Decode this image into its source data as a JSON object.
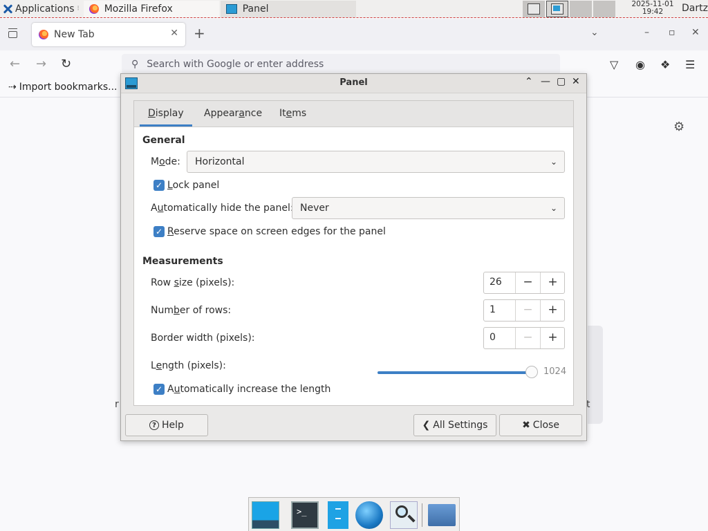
{
  "top_panel": {
    "apps_label": "Applications",
    "tasks": [
      {
        "label": "Mozilla Firefox",
        "icon": "firefox-icon"
      },
      {
        "label": "Panel",
        "icon": "panel-icon"
      }
    ],
    "clock": {
      "date": "2025-11-01",
      "time": "19:42"
    },
    "user": "Dartz"
  },
  "firefox": {
    "tab_title": "New Tab",
    "tab_close": "✕",
    "new_tab": "+",
    "overflow": "⌄",
    "window": {
      "minimize": "–",
      "maximize": "▫",
      "close": "✕"
    },
    "nav": {
      "back": "←",
      "forward": "→",
      "reload": "↻"
    },
    "url_placeholder": "Search with Google or enter address",
    "bookmarks_import": "Import bookmarks...",
    "bg_letter_left": "r",
    "bg_letter_right": "t"
  },
  "dialog": {
    "title": "Panel",
    "tabs": [
      {
        "pre": "",
        "u": "D",
        "post": "isplay"
      },
      {
        "pre": "Appear",
        "u": "a",
        "post": "nce"
      },
      {
        "pre": "It",
        "u": "e",
        "post": "ms"
      }
    ],
    "general_heading": "General",
    "mode": {
      "pre": "M",
      "u": "o",
      "post": "de:",
      "value": "Horizontal"
    },
    "lock_panel": {
      "u": "L",
      "post": "ock panel",
      "checked": true
    },
    "autohide": {
      "pre": "A",
      "u": "u",
      "post": "tomatically hide the panel:",
      "value": "Never"
    },
    "reserve_space": {
      "u": "R",
      "post": "eserve space on screen edges for the panel",
      "checked": true
    },
    "measurements_heading": "Measurements",
    "row_size": {
      "pre": "Row ",
      "u": "s",
      "post": "ize (pixels):",
      "value": "26"
    },
    "num_rows": {
      "pre": "Num",
      "u": "b",
      "post": "er of rows:",
      "value": "1"
    },
    "border_width": {
      "pre": "Border width (pixels):",
      "value": "0"
    },
    "length": {
      "pre": "L",
      "u": "e",
      "post": "ngth (pixels):",
      "value": "1024",
      "fraction": 1.0
    },
    "auto_increase": {
      "pre": "A",
      "u": "u",
      "post": "tomatically increase the length",
      "checked": true
    },
    "buttons": {
      "help": "Help",
      "all_settings": "All Settings",
      "close": "Close"
    }
  },
  "dock": {
    "launchers": [
      "desktop-icon",
      "terminal-icon",
      "file-manager-icon",
      "web-browser-icon",
      "app-finder-icon",
      "folder-icon"
    ]
  },
  "colors": {
    "accent": "#3d7fc5",
    "panel_bg": "#f0efee"
  }
}
